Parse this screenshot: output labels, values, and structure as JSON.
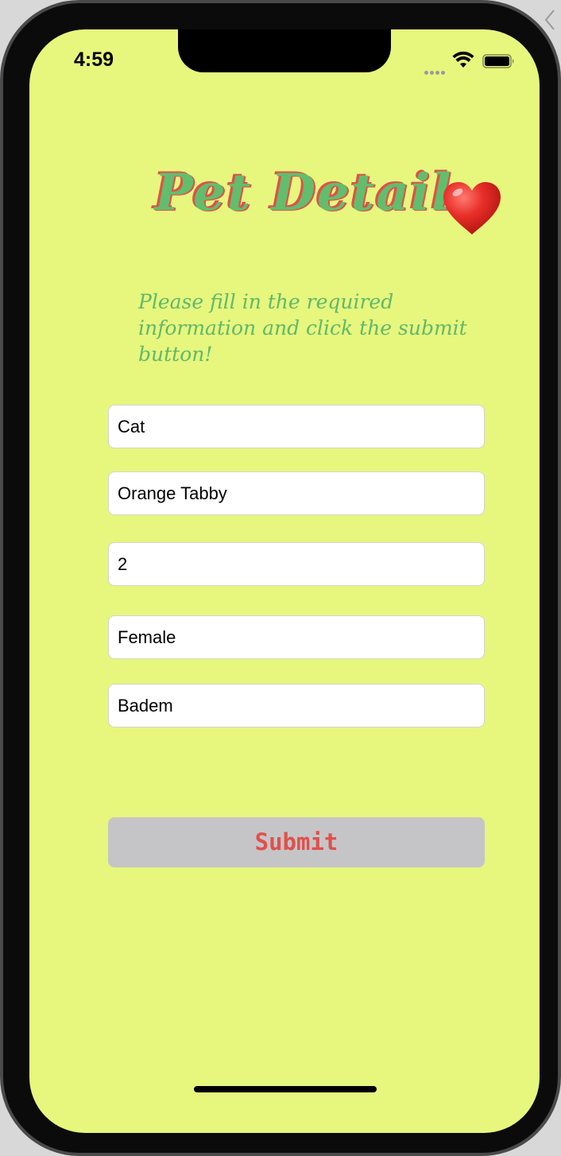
{
  "status_bar": {
    "time": "4:59"
  },
  "header": {
    "title": "Pet Detail",
    "title_icon": "heart-icon",
    "subtitle": "Please fill in the required information and click the submit button!"
  },
  "form": {
    "fields": [
      {
        "name": "type",
        "value": "Cat"
      },
      {
        "name": "breed",
        "value": "Orange Tabby"
      },
      {
        "name": "age",
        "value": "2"
      },
      {
        "name": "gender",
        "value": "Female"
      },
      {
        "name": "pet-name",
        "value": "Badem"
      }
    ],
    "submit_label": "Submit"
  },
  "colors": {
    "background": "#e7f67d",
    "title_green": "#62be6c",
    "accent_red": "#e0504b",
    "button_gray": "#c5c5c8"
  }
}
